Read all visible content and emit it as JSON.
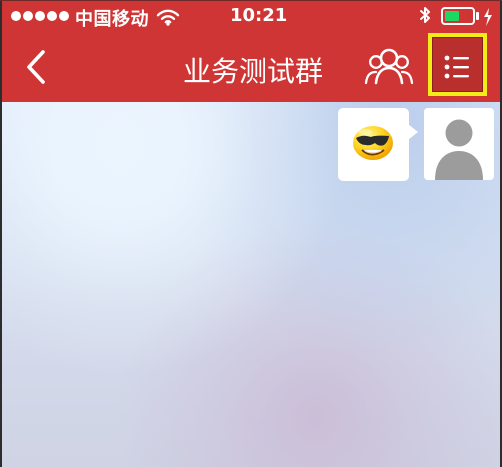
{
  "status_bar": {
    "carrier": "中国移动",
    "time": "10:21",
    "battery_level": 0.55
  },
  "nav": {
    "title": "业务测试群"
  },
  "colors": {
    "header_red": "#CE3534",
    "highlight_yellow": "#F4EC19",
    "battery_green": "#1ED760"
  },
  "icons": {
    "back": "chevron-left-icon",
    "group": "group-members-icon",
    "menu": "list-menu-icon",
    "emoji": "cool-face-icon",
    "avatar": "user-avatar-icon",
    "wifi": "wifi-icon",
    "bluetooth": "bluetooth-icon",
    "charging": "charging-bolt-icon"
  }
}
